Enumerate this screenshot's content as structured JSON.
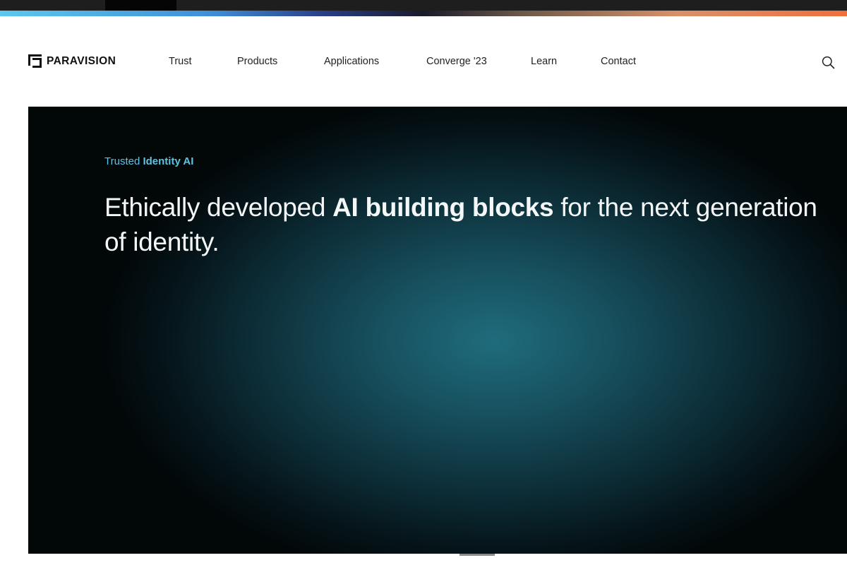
{
  "brand": {
    "name": "PARAVISION"
  },
  "nav": {
    "items": [
      {
        "label": "Trust"
      },
      {
        "label": "Products"
      },
      {
        "label": "Applications"
      },
      {
        "label": "Converge '23"
      },
      {
        "label": "Learn"
      },
      {
        "label": "Contact"
      }
    ],
    "search_icon": "search-icon"
  },
  "hero": {
    "eyebrow_light": "Trusted",
    "eyebrow_bold": "Identity AI",
    "heading_part1": "Ethically developed ",
    "heading_bold": "AI building blocks",
    "heading_part2": " for the next generation of identity."
  },
  "colors": {
    "accent": "#5fc3e4",
    "hero_glow": "#1f6c7d",
    "hero_dark": "#020708",
    "heading_text": "#f4f7f8",
    "nav_text": "#222222"
  }
}
